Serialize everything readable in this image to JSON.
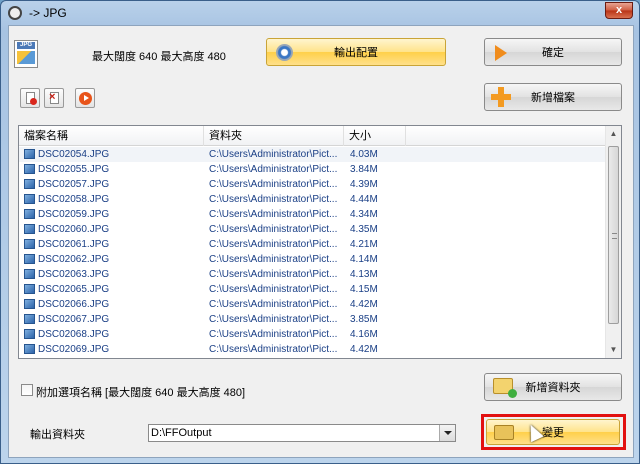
{
  "window": {
    "title": "-> JPG",
    "close_glyph": "x"
  },
  "header": {
    "size_label": "最大闊度 640 最大高度 480",
    "config_button": "輸出配置",
    "ok_button": "確定",
    "add_file_button": "新增檔案"
  },
  "file_list": {
    "columns": [
      "檔案名稱",
      "資料夾",
      "大小"
    ],
    "rows": [
      {
        "name": "DSC02054.JPG",
        "folder": "C:\\Users\\Administrator\\Pict...",
        "size": "4.03M"
      },
      {
        "name": "DSC02055.JPG",
        "folder": "C:\\Users\\Administrator\\Pict...",
        "size": "3.84M"
      },
      {
        "name": "DSC02057.JPG",
        "folder": "C:\\Users\\Administrator\\Pict...",
        "size": "4.39M"
      },
      {
        "name": "DSC02058.JPG",
        "folder": "C:\\Users\\Administrator\\Pict...",
        "size": "4.44M"
      },
      {
        "name": "DSC02059.JPG",
        "folder": "C:\\Users\\Administrator\\Pict...",
        "size": "4.34M"
      },
      {
        "name": "DSC02060.JPG",
        "folder": "C:\\Users\\Administrator\\Pict...",
        "size": "4.35M"
      },
      {
        "name": "DSC02061.JPG",
        "folder": "C:\\Users\\Administrator\\Pict...",
        "size": "4.21M"
      },
      {
        "name": "DSC02062.JPG",
        "folder": "C:\\Users\\Administrator\\Pict...",
        "size": "4.14M"
      },
      {
        "name": "DSC02063.JPG",
        "folder": "C:\\Users\\Administrator\\Pict...",
        "size": "4.13M"
      },
      {
        "name": "DSC02065.JPG",
        "folder": "C:\\Users\\Administrator\\Pict...",
        "size": "4.15M"
      },
      {
        "name": "DSC02066.JPG",
        "folder": "C:\\Users\\Administrator\\Pict...",
        "size": "4.42M"
      },
      {
        "name": "DSC02067.JPG",
        "folder": "C:\\Users\\Administrator\\Pict...",
        "size": "3.85M"
      },
      {
        "name": "DSC02068.JPG",
        "folder": "C:\\Users\\Administrator\\Pict...",
        "size": "4.16M"
      },
      {
        "name": "DSC02069.JPG",
        "folder": "C:\\Users\\Administrator\\Pict...",
        "size": "4.42M"
      }
    ]
  },
  "options": {
    "append_option_label": "附加選項名稱 [最大闊度 640 最大高度 480]",
    "add_folder_button": "新增資料夾",
    "output_folder_label": "輸出資料夾",
    "output_folder_value": "D:\\FFOutput",
    "change_button": "變更"
  },
  "icons": {
    "jpg_badge": "JPG"
  },
  "colors": {
    "highlight": "#e21010",
    "accent_yellow": "#ffd04a"
  }
}
